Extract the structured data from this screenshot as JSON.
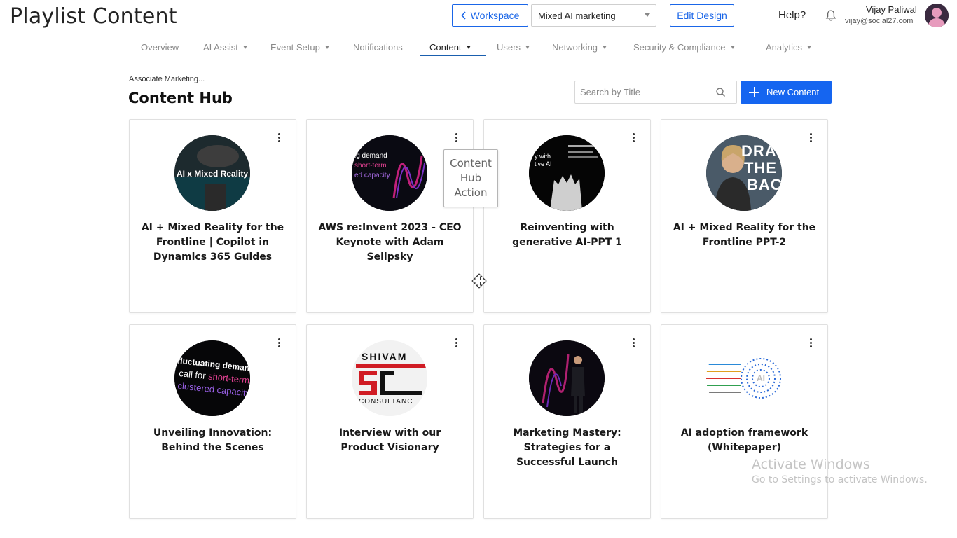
{
  "header": {
    "page_title": "Playlist Content",
    "workspace_button": "Workspace",
    "event_select": "Mixed AI marketing",
    "edit_design_button": "Edit Design",
    "help": "Help?",
    "user": {
      "name": "Vijay Paliwal",
      "email": "vijay@social27.com"
    }
  },
  "nav": {
    "items": [
      {
        "label": "Overview",
        "has_menu": false
      },
      {
        "label": "AI Assist",
        "has_menu": true
      },
      {
        "label": "Event Setup",
        "has_menu": true
      },
      {
        "label": "Notifications",
        "has_menu": false
      },
      {
        "label": "Content",
        "has_menu": true,
        "active": true
      },
      {
        "label": "Users",
        "has_menu": true
      },
      {
        "label": "Networking",
        "has_menu": true
      },
      {
        "label": "Security & Compliance",
        "has_menu": true
      },
      {
        "label": "Analytics",
        "has_menu": true
      }
    ]
  },
  "content": {
    "breadcrumb": "Associate Marketing...",
    "title": "Content Hub",
    "search_placeholder": "Search by Title",
    "new_button": "New Content"
  },
  "tooltip": "Content Hub Action",
  "cards": [
    {
      "title": "AI + Mixed Reality for the Frontline | Copilot in Dynamics 365 Guides",
      "thumb_text": "AI x Mixed Reality"
    },
    {
      "title": "AWS re:Invent 2023 - CEO Keynote with Adam Selipsky",
      "thumb_text": "ig demand short-term ed capacity"
    },
    {
      "title": "Reinventing with generative AI-PPT 1",
      "thumb_text": "y with tive AI"
    },
    {
      "title": "AI + Mixed Reality for the Frontline PPT-2",
      "thumb_text": "DRA THE BAC"
    },
    {
      "title": "Unveiling Innovation: Behind the Scenes",
      "thumb_text": "fluctuating demands call for short-term clustered capacity"
    },
    {
      "title": "Interview with our Product Visionary",
      "thumb_text": "SHIVAM CONSULTANC"
    },
    {
      "title": "Marketing Mastery: Strategies for a Successful Launch",
      "thumb_text": ""
    },
    {
      "title": "AI adoption framework (Whitepaper)",
      "thumb_text": "AI"
    }
  ],
  "watermark": {
    "line1": "Activate Windows",
    "line2": "Go to Settings to activate Windows."
  },
  "colors": {
    "accent": "#1565f0",
    "active_tab": "#1a5fae"
  }
}
